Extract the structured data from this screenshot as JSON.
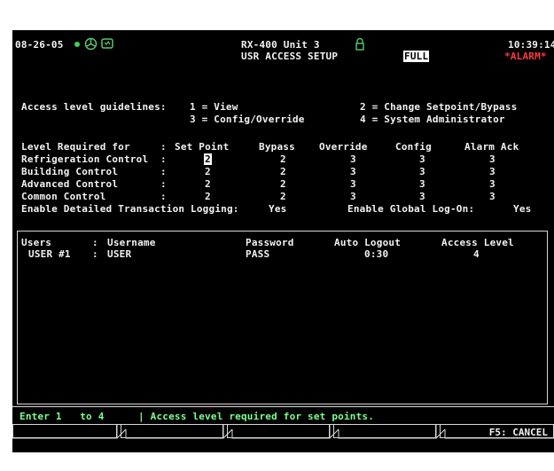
{
  "header": {
    "date": "08-26-05",
    "unit_name": "RX-400 Unit 3",
    "screen_title": "USR ACCESS SETUP",
    "mode_badge": "FULL",
    "time": "10:39:14",
    "alarm_badge": "*ALARM*"
  },
  "guidelines": {
    "label": "Access level guidelines:",
    "level1": "1 = View",
    "level2": "2 = Change Setpoint/Bypass",
    "level3": "3 = Config/Override",
    "level4": "4 = System Administrator"
  },
  "levels_table": {
    "header_label": "Level Required for",
    "columns": [
      "Set Point",
      "Bypass",
      "Override",
      "Config",
      "Alarm Ack"
    ],
    "rows": [
      {
        "label": "Refrigeration Control",
        "values": [
          "2",
          "2",
          "3",
          "3",
          "3"
        ]
      },
      {
        "label": "Building Control",
        "values": [
          "2",
          "2",
          "3",
          "3",
          "3"
        ]
      },
      {
        "label": "Advanced Control",
        "values": [
          "2",
          "2",
          "3",
          "3",
          "3"
        ]
      },
      {
        "label": "Common Control",
        "values": [
          "2",
          "2",
          "3",
          "3",
          "3"
        ]
      }
    ]
  },
  "logging": {
    "detailed_label": "Enable Detailed Transaction Logging:",
    "detailed_value": "Yes",
    "global_label": "Enable Global Log-On:",
    "global_value": "Yes"
  },
  "users": {
    "columns": {
      "users": "Users",
      "username": "Username",
      "password": "Password",
      "auto_logout": "Auto Logout",
      "access_level": "Access Level"
    },
    "rows": [
      {
        "user": "USER #1",
        "username": "USER",
        "password": "PASS",
        "auto_logout": "0:30",
        "access_level": "4"
      }
    ]
  },
  "status_line": {
    "range": "Enter 1   to 4",
    "message": "| Access level required for set points."
  },
  "function_keys": {
    "f5": "F5: CANCEL"
  },
  "colors": {
    "background": "#000000",
    "text": "#f2f2f2",
    "status_green": "#7dff8f",
    "alarm_red": "#ff3b3b"
  }
}
